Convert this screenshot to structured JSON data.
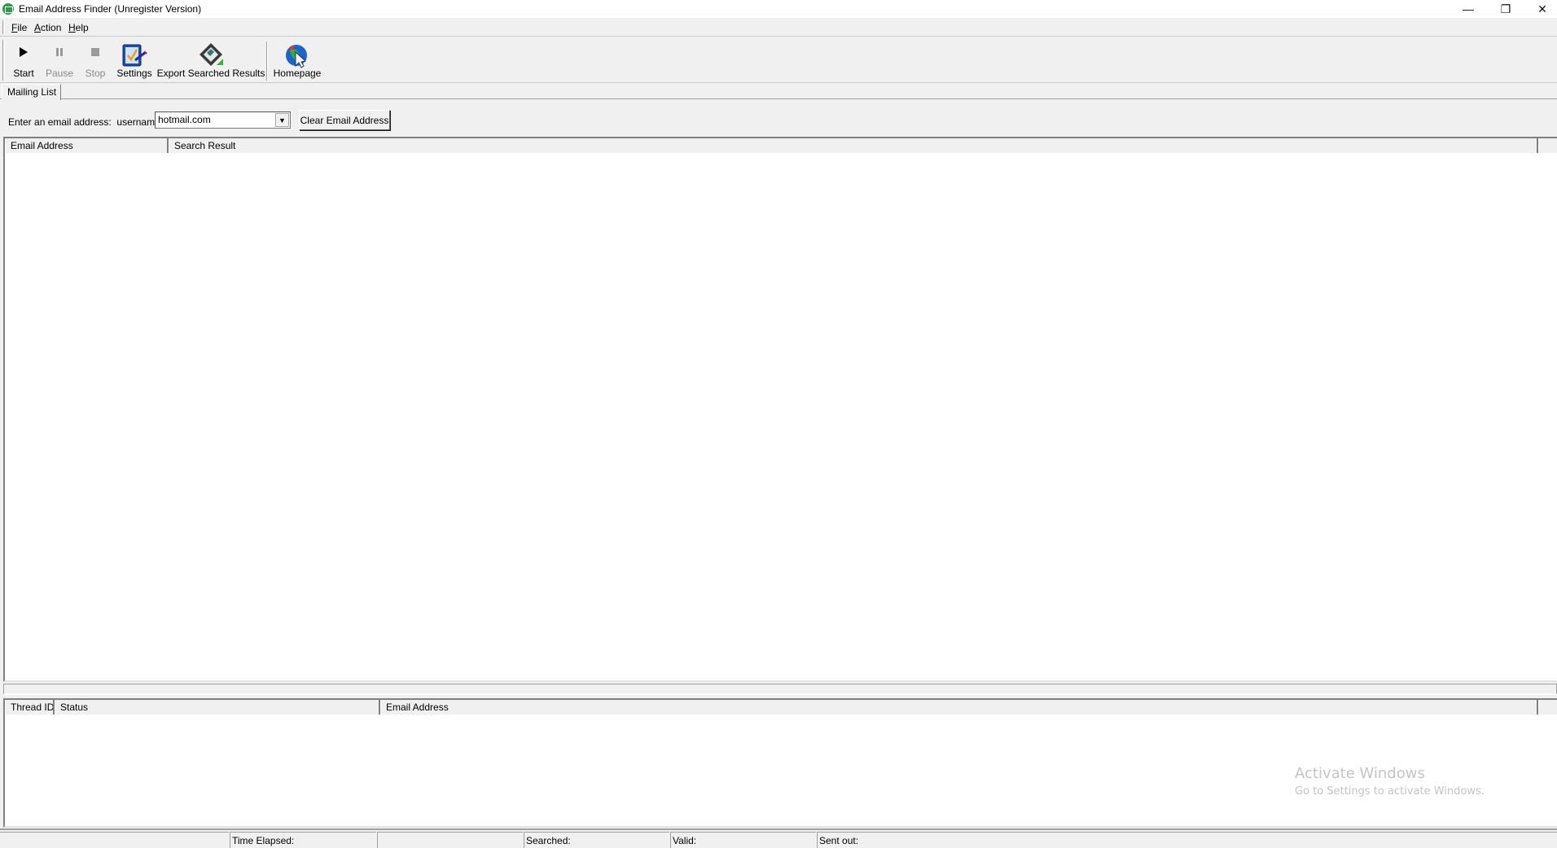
{
  "window": {
    "title": "Email Address Finder (Unregister Version)",
    "controls": {
      "minimize": "—",
      "restore": "❐",
      "close": "✕"
    }
  },
  "menu": {
    "items": [
      {
        "label": "File",
        "accel": "F",
        "rest": "ile"
      },
      {
        "label": "Action",
        "accel": "A",
        "rest": "ction"
      },
      {
        "label": "Help",
        "accel": "H",
        "rest": "elp"
      }
    ]
  },
  "toolbar": {
    "buttons": [
      {
        "label": "Start",
        "icon": "play-icon",
        "enabled": true
      },
      {
        "label": "Pause",
        "icon": "pause-icon",
        "enabled": false
      },
      {
        "label": "Stop",
        "icon": "stop-icon",
        "enabled": false
      },
      {
        "label": "Settings",
        "icon": "settings-checklist-icon",
        "enabled": true
      },
      {
        "label": "Export Searched Results",
        "icon": "floppy-disk-export-icon",
        "enabled": true
      },
      {
        "label": "Homepage",
        "icon": "globe-cursor-icon",
        "enabled": true
      }
    ]
  },
  "tabs": [
    {
      "label": "Mailing List",
      "active": true
    }
  ],
  "input_row": {
    "label": "Enter an email address:  username@",
    "domain_value": "hotmail.com",
    "clear_button": "Clear Email Address"
  },
  "upper_list": {
    "columns": [
      "Email Address",
      "Search Result",
      ""
    ],
    "rows": []
  },
  "lower_list": {
    "columns": [
      "Thread ID",
      "Status",
      "Email Address",
      ""
    ],
    "rows": []
  },
  "watermark": {
    "line1": "Activate Windows",
    "line2": "Go to Settings to activate Windows."
  },
  "statusbar": {
    "panels": [
      "",
      "Time Elapsed:",
      "",
      "Searched:",
      "Valid:",
      "Sent out:"
    ]
  }
}
